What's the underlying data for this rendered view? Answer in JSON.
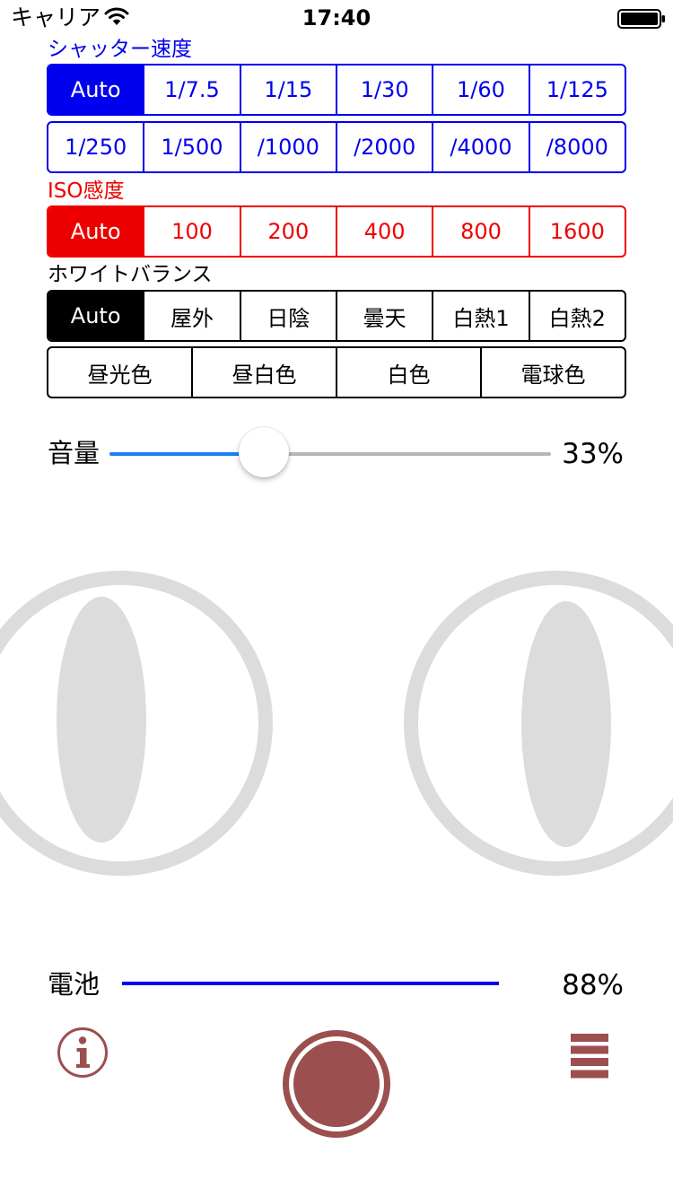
{
  "status_bar": {
    "carrier": "キャリア",
    "time": "17:40",
    "icons": [
      "wifi-icon",
      "battery-icon"
    ]
  },
  "shutter_speed": {
    "label": "シャッター速度",
    "color": "#0000ee",
    "row1": [
      "Auto",
      "1/7.5",
      "1/15",
      "1/30",
      "1/60",
      "1/125"
    ],
    "row2": [
      "1/250",
      "1/500",
      "/1000",
      "/2000",
      "/4000",
      "/8000"
    ],
    "selected": "Auto"
  },
  "iso": {
    "label": "ISO感度",
    "color": "#ee0000",
    "options": [
      "Auto",
      "100",
      "200",
      "400",
      "800",
      "1600"
    ],
    "selected": "Auto"
  },
  "white_balance": {
    "label": "ホワイトバランス",
    "color": "#000000",
    "row1": [
      "Auto",
      "屋外",
      "日陰",
      "曇天",
      "白熱1",
      "白熱2"
    ],
    "row2": [
      "昼光色",
      "昼白色",
      "白色",
      "電球色"
    ],
    "selected": "Auto"
  },
  "volume": {
    "label": "音量",
    "value_text": "33%",
    "level": 0.33,
    "fill_color": "#1a7ef4"
  },
  "battery": {
    "label": "電池",
    "value_text": "88%",
    "level": 0.88,
    "bar_color": "#0000ee"
  },
  "toolbar": {
    "accent_color": "#9b4f4e",
    "info_icon": "info-icon",
    "shutter_icon": "shutter-icon",
    "menu_icon": "menu-icon"
  }
}
